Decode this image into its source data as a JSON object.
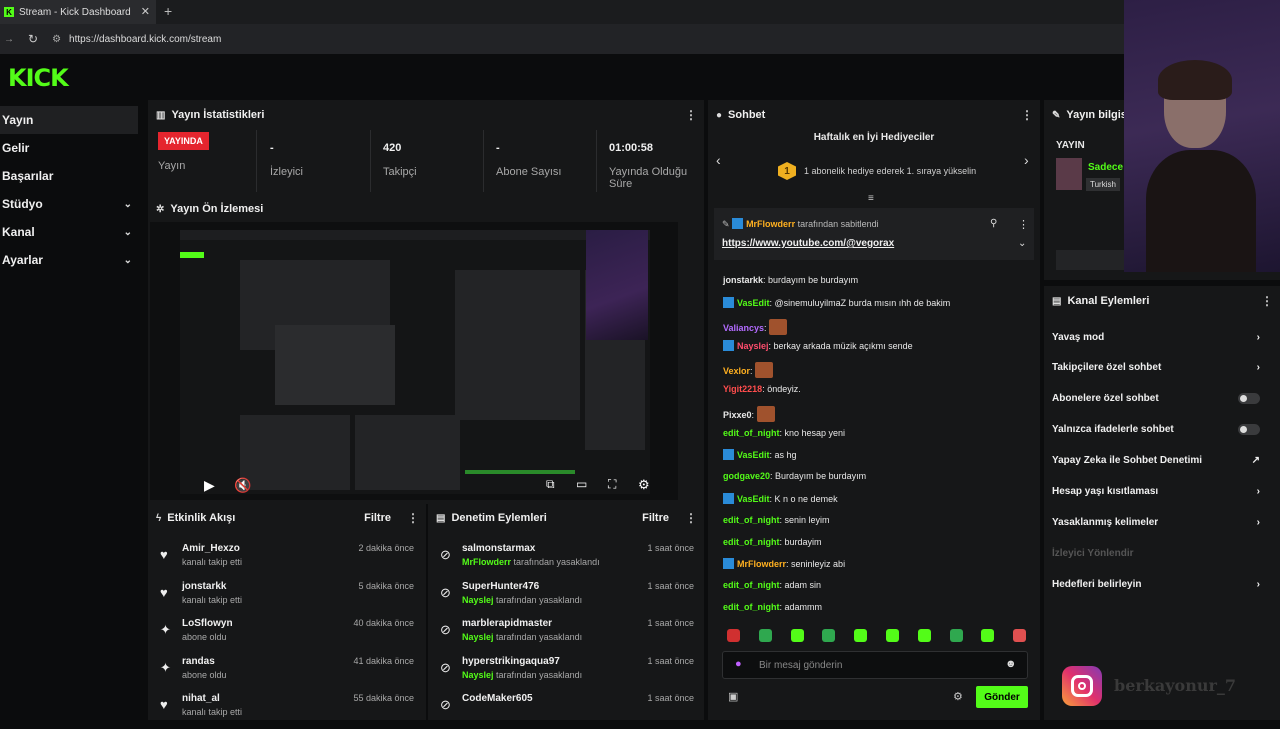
{
  "browser": {
    "tab_title": "Stream - Kick Dashboard",
    "tab_close": "✕",
    "new_tab": "+",
    "url": "https://dashboard.kick.com/stream"
  },
  "logo": "KICK",
  "sidebar": {
    "items": [
      {
        "label": "Yayın",
        "active": true
      },
      {
        "label": "Gelir"
      },
      {
        "label": "Başarılar"
      },
      {
        "label": "Stüdyo",
        "expandable": true
      },
      {
        "label": "Kanal",
        "expandable": true
      },
      {
        "label": "Ayarlar",
        "expandable": true
      }
    ]
  },
  "stats_panel": {
    "title": "Yayın İstatistikleri",
    "live_badge": "YAYINDA",
    "live_label": "Yayın",
    "stats": [
      {
        "value": "-",
        "label": "İzleyici"
      },
      {
        "value": "420",
        "label": "Takipçi"
      },
      {
        "value": "-",
        "label": "Abone Sayısı"
      },
      {
        "value": "01:00:58",
        "label": "Yayında Olduğu Süre"
      }
    ]
  },
  "preview_panel": {
    "title": "Yayın Ön İzlemesi"
  },
  "activity": {
    "title": "Etkinlik Akışı",
    "filter": "Filtre",
    "items": [
      {
        "icon": "heart-icon",
        "name": "Amir_Hexzo",
        "sub": "kanalı takip etti",
        "time": "2 dakika önce"
      },
      {
        "icon": "heart-icon",
        "name": "jonstarkk",
        "sub": "kanalı takip etti",
        "time": "5 dakika önce"
      },
      {
        "icon": "star-icon",
        "name": "LoSflowyn",
        "sub": "abone oldu",
        "time": "40 dakika önce"
      },
      {
        "icon": "star-icon",
        "name": "randas",
        "sub": "abone oldu",
        "time": "41 dakika önce"
      },
      {
        "icon": "heart-icon",
        "name": "nihat_al",
        "sub": "kanalı takip etti",
        "time": "55 dakika önce"
      }
    ]
  },
  "moderation": {
    "title": "Denetim Eylemleri",
    "filter": "Filtre",
    "suffix": "tarafından yasaklandı",
    "items": [
      {
        "name": "salmonstarmax",
        "by": "MrFlowderr",
        "time": "1 saat önce"
      },
      {
        "name": "SuperHunter476",
        "by": "Nayslej",
        "time": "1 saat önce"
      },
      {
        "name": "marblerapidmaster",
        "by": "Nayslej",
        "time": "1 saat önce"
      },
      {
        "name": "hyperstrikingaqua97",
        "by": "Nayslej",
        "time": "1 saat önce"
      },
      {
        "name": "CodeMaker605",
        "by": "",
        "time": "1 saat önce"
      }
    ]
  },
  "chat": {
    "title": "Sohbet",
    "gifters_title": "Haftalık en İyi Hediyeciler",
    "gifter_rank": "1",
    "gifters_text": "1 abonelik hediye ederek 1. sıraya yükselin",
    "pinned_by": "MrFlowderr",
    "pinned_suffix": "tarafından sabitlendi",
    "pinned_link": "https://www.youtube.com/@vegorax",
    "messages": [
      {
        "user": "jonstarkk",
        "color": "#e8e8e8",
        "text": "burdayım be burdayım",
        "mod": false
      },
      {
        "user": "VasEdit",
        "color": "#53fc18",
        "text": "@sinemuluyilmaZ burda mısın ıhh de bakim",
        "mod": true
      },
      {
        "user": "Valiancys",
        "color": "#b36bff",
        "text": "",
        "mod": false,
        "emote": true
      },
      {
        "user": "Nayslej",
        "color": "#ff4d6d",
        "text": "berkay arkada müzik açıkmı sende",
        "mod": true
      },
      {
        "user": "Vexlor",
        "color": "#ffb020",
        "text": "",
        "mod": false,
        "emote": true
      },
      {
        "user": "Yigit2218",
        "color": "#ff4d4d",
        "text": "öndeyiz.",
        "mod": false
      },
      {
        "user": "Pixxe0",
        "color": "#e8e8e8",
        "text": "",
        "mod": false,
        "emote": true
      },
      {
        "user": "edit_of_night",
        "color": "#53fc18",
        "text": "kno hesap yeni",
        "mod": false
      },
      {
        "user": "VasEdit",
        "color": "#53fc18",
        "text": "as hg",
        "mod": true
      },
      {
        "user": "godgave20",
        "color": "#53fc18",
        "text": "Burdayım be burdayım",
        "mod": false
      },
      {
        "user": "VasEdit",
        "color": "#53fc18",
        "text": "K n o ne demek",
        "mod": true
      },
      {
        "user": "edit_of_night",
        "color": "#53fc18",
        "text": "senin leyim",
        "mod": false
      },
      {
        "user": "edit_of_night",
        "color": "#53fc18",
        "text": "burdayim",
        "mod": false
      },
      {
        "user": "MrFlowderr",
        "color": "#ffb020",
        "text": "seninleyiz abi",
        "mod": true
      },
      {
        "user": "edit_of_night",
        "color": "#53fc18",
        "text": "adam sin",
        "mod": false
      },
      {
        "user": "edit_of_night",
        "color": "#53fc18",
        "text": "adammm",
        "mod": false
      }
    ],
    "input_placeholder": "Bir mesaj gönderin",
    "send_label": "Gönder"
  },
  "stream_info": {
    "title": "Yayın bilgisi",
    "status": "YAYIN",
    "title_snippet": "Sadece",
    "tag": "Turkish"
  },
  "channel_actions": {
    "title": "Kanal Eylemleri",
    "items": [
      {
        "label": "Yavaş mod",
        "control": "chevron"
      },
      {
        "label": "Takipçilere özel sohbet",
        "control": "chevron"
      },
      {
        "label": "Abonelere özel sohbet",
        "control": "toggle"
      },
      {
        "label": "Yalnızca ifadelerle sohbet",
        "control": "toggle"
      },
      {
        "label": "Yapay Zeka ile Sohbet Denetimi",
        "control": "external"
      },
      {
        "label": "Hesap yaşı kısıtlaması",
        "control": "chevron"
      },
      {
        "label": "Yasaklanmış kelimeler",
        "control": "chevron"
      },
      {
        "label": "İzleyici Yönlendir",
        "control": "none",
        "disabled": true
      },
      {
        "label": "Hedefleri belirleyin",
        "control": "chevron"
      }
    ]
  },
  "watermark": "berkayonur_7",
  "colors": {
    "accent": "#53fc18",
    "live": "#e5252e",
    "panel": "#161718",
    "bg": "#0b0c0d"
  }
}
